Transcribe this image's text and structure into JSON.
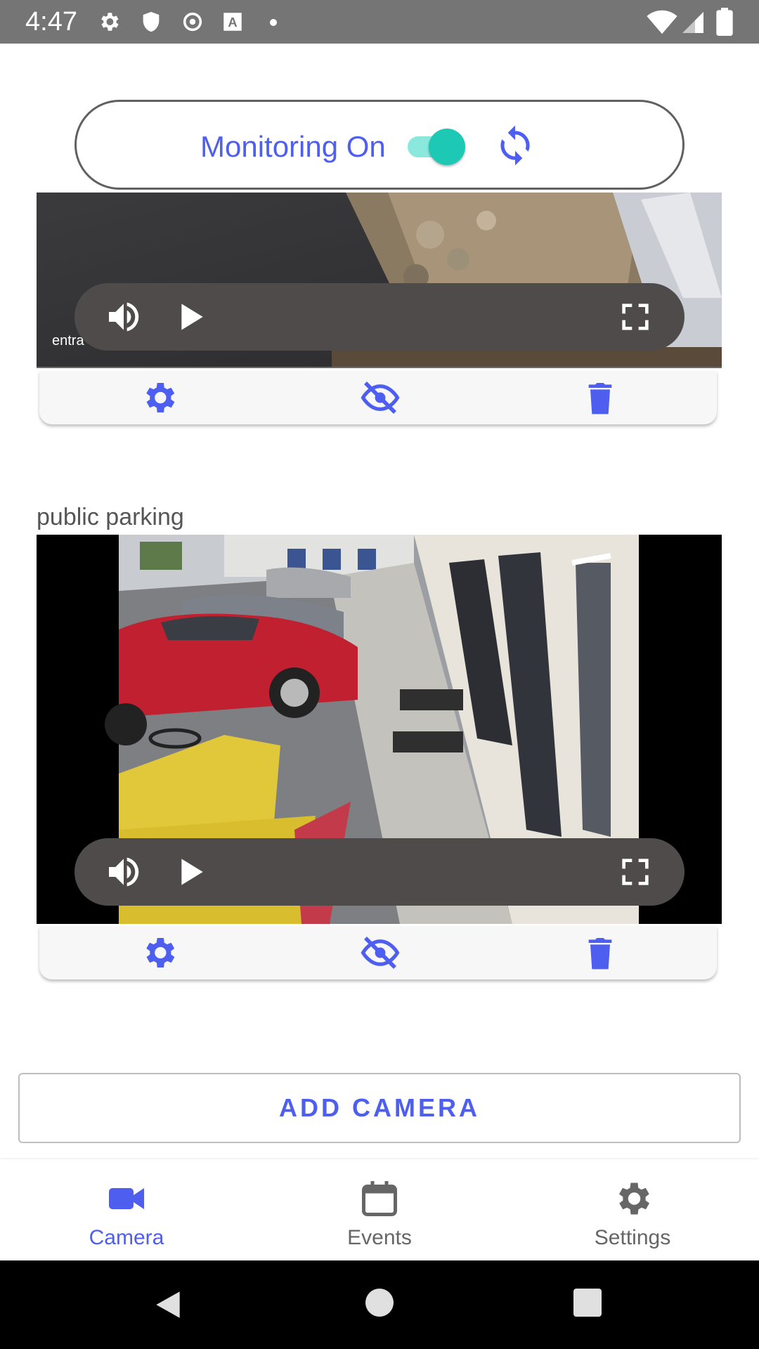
{
  "status_bar": {
    "time": "4:47",
    "left_icons": [
      "gear-icon",
      "shield-icon",
      "vpn-icon",
      "font-icon",
      "dot-icon"
    ],
    "right_icons": [
      "wifi-icon",
      "signal-icon",
      "battery-icon"
    ]
  },
  "monitoring": {
    "label": "Monitoring On",
    "toggle_on": true,
    "refresh_icon": "refresh-icon"
  },
  "cameras": [
    {
      "name": "",
      "overlay_text": "entra",
      "controls": [
        "volume-icon",
        "play-icon",
        "fullscreen-icon"
      ],
      "actions": [
        "gear-icon",
        "eye-off-icon",
        "trash-icon"
      ]
    },
    {
      "name": "public parking",
      "controls": [
        "volume-icon",
        "play-icon",
        "fullscreen-icon"
      ],
      "actions": [
        "gear-icon",
        "eye-off-icon",
        "trash-icon"
      ]
    }
  ],
  "add_camera_label": "ADD CAMERA",
  "bottom_nav": {
    "items": [
      {
        "label": "Camera",
        "icon": "video-camera-icon",
        "active": true
      },
      {
        "label": "Events",
        "icon": "calendar-icon",
        "active": false
      },
      {
        "label": "Settings",
        "icon": "gear-icon",
        "active": false
      }
    ]
  },
  "colors": {
    "accent": "#4e5ff0",
    "toggle": "#1dc9b4",
    "controls_bg": "#4f4b4b",
    "inactive": "#666666"
  }
}
